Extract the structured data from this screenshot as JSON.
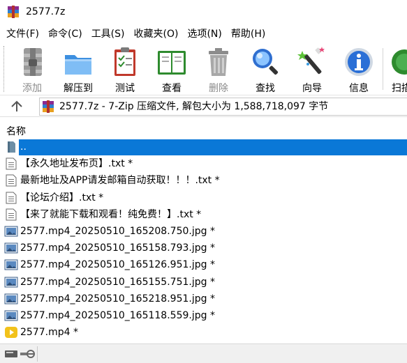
{
  "window": {
    "title": "2577.7z"
  },
  "menu": [
    {
      "label": "文件(F)"
    },
    {
      "label": "命令(C)"
    },
    {
      "label": "工具(S)"
    },
    {
      "label": "收藏夹(O)"
    },
    {
      "label": "选项(N)"
    },
    {
      "label": "帮助(H)"
    }
  ],
  "toolbar": {
    "add": "添加",
    "extract": "解压到",
    "test": "测试",
    "view": "查看",
    "delete": "删除",
    "find": "查找",
    "wizard": "向导",
    "info": "信息",
    "scan": "扫描"
  },
  "address": {
    "text": "2577.7z - 7-Zip 压缩文件, 解包大小为 1,588,718,097 字节"
  },
  "list": {
    "column_name": "名称",
    "rows": [
      {
        "name": "..",
        "icon": "folder-up-icon",
        "selected": true
      },
      {
        "name": "【永久地址发布页】.txt *",
        "icon": "text-file-icon"
      },
      {
        "name": "最新地址及APP请发邮箱自动获取！！！.txt *",
        "icon": "text-file-icon"
      },
      {
        "name": "【论坛介绍】.txt *",
        "icon": "text-file-icon"
      },
      {
        "name": "【来了就能下载和观看！纯免费！】.txt *",
        "icon": "text-file-icon"
      },
      {
        "name": "2577.mp4_20250510_165208.750.jpg *",
        "icon": "image-file-icon"
      },
      {
        "name": "2577.mp4_20250510_165158.793.jpg *",
        "icon": "image-file-icon"
      },
      {
        "name": "2577.mp4_20250510_165126.951.jpg *",
        "icon": "image-file-icon"
      },
      {
        "name": "2577.mp4_20250510_165155.751.jpg *",
        "icon": "image-file-icon"
      },
      {
        "name": "2577.mp4_20250510_165218.951.jpg *",
        "icon": "image-file-icon"
      },
      {
        "name": "2577.mp4_20250510_165118.559.jpg *",
        "icon": "image-file-icon"
      },
      {
        "name": "2577.mp4 *",
        "icon": "video-file-icon"
      }
    ]
  },
  "colors": {
    "selection": "#0a78d7"
  }
}
